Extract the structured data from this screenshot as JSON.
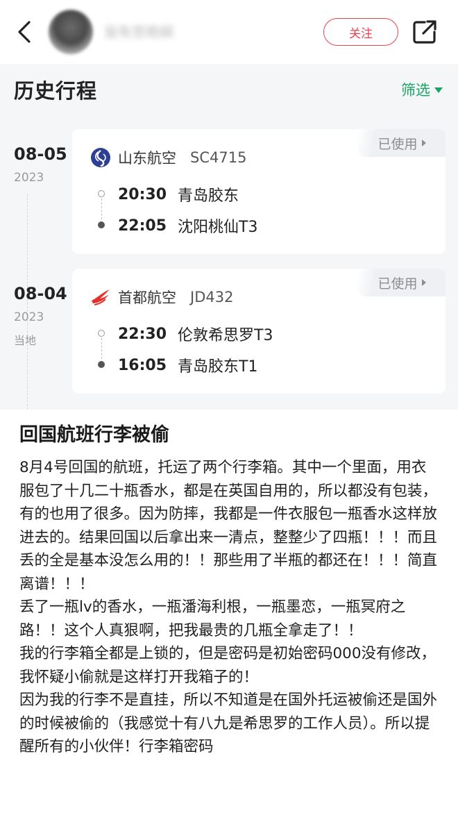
{
  "header": {
    "username": "皆有思皓娴",
    "follow_label": "关注"
  },
  "trips": {
    "title": "历史行程",
    "filter_label": "筛选",
    "items": [
      {
        "date": "08-05",
        "year": "2023",
        "local": "",
        "status": "已使用",
        "airline": "山东航空",
        "flight": "SC4715",
        "dep_time": "20:30",
        "dep_place": "青岛胶东",
        "arr_time": "22:05",
        "arr_place": "沈阳桃仙T3",
        "logo_icon": "shandong-airlines-logo-icon",
        "logo_color": "#2f3f94"
      },
      {
        "date": "08-04",
        "year": "2023",
        "local": "当地",
        "status": "已使用",
        "airline": "首都航空",
        "flight": "JD432",
        "dep_time": "22:30",
        "dep_place": "伦敦希思罗T3",
        "arr_time": "16:05",
        "arr_place": "青岛胶东T1",
        "logo_icon": "capital-airlines-logo-icon",
        "logo_color": "#e2322a"
      }
    ]
  },
  "post": {
    "title": "回国航班行李被偷",
    "paragraphs": [
      "8月4号回国的航班，托运了两个行李箱。其中一个里面，用衣服包了十几二十瓶香水，都是在英国自用的，所以都没有包装，有的也用了很多。因为防摔，我都是一件衣服包一瓶香水这样放进去的。结果回国以后拿出来一清点，整整少了四瓶！！！而且丢的全是基本没怎么用的！！那些用了半瓶的都还在！！！简直离谱！！！",
      "丢了一瓶lv的香水，一瓶潘海利根，一瓶墨恋，一瓶冥府之路！！这个人真狠啊，把我最贵的几瓶全拿走了！！",
      "我的行李箱全都是上锁的，但是密码是初始密码000没有修改，我怀疑小偷就是这样打开我箱子的！",
      "因为我的行李不是直挂，所以不知道是在国外托运被偷还是国外的时候被偷的（我感觉十有八九是希思罗的工作人员）。所以提醒所有的小伙伴！行李箱密码"
    ]
  },
  "colors": {
    "accent_red": "#e8424f",
    "filter_green": "#19a463"
  }
}
